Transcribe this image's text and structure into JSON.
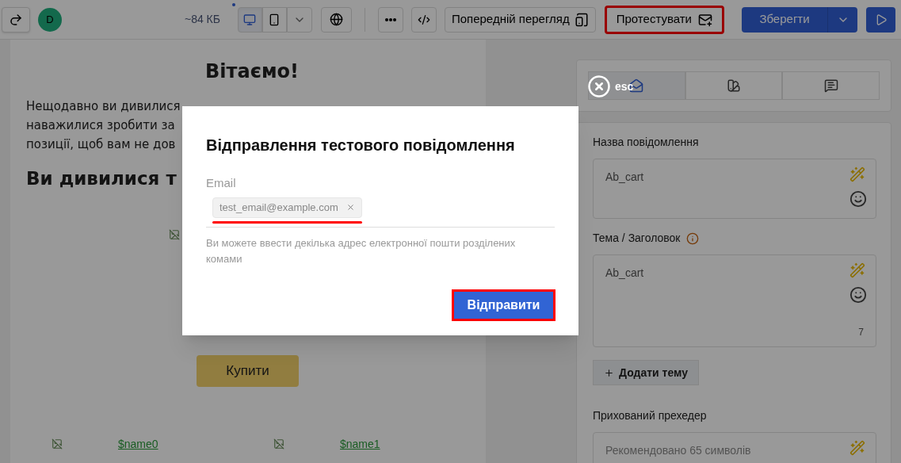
{
  "toolbar": {
    "avatar": "D",
    "size": "~84 КБ",
    "devices": [
      {
        "kind": "desktop",
        "selected": true
      },
      {
        "kind": "mobile",
        "selected": false
      }
    ],
    "preview_button": "Попередній перегляд",
    "test_button": {
      "label": "Протестувати",
      "highlighted": true
    },
    "save_button": "Зберегти"
  },
  "email_preview": {
    "greeting": "Вітаємо!",
    "intro_lines": [
      "Нещодавно ви дивилися",
      "наважилися зробити за",
      "позиції, щоб вам не дов"
    ],
    "section_heading": "Ви дивилися т",
    "buy_button": "Купити",
    "products": [
      {
        "name": "$name0"
      },
      {
        "name": "$name1"
      }
    ]
  },
  "settings": {
    "tabs": [
      {
        "kind": "envelope",
        "selected": true
      },
      {
        "kind": "palette",
        "selected": false
      },
      {
        "kind": "chat",
        "selected": false
      }
    ],
    "fields": [
      {
        "label": "Назва повідомлення",
        "value": "Ab_cart",
        "warning": false
      },
      {
        "label": "Тема / Заголовок",
        "value": "Ab_cart",
        "warning": true,
        "count": "7"
      }
    ],
    "add_subject_button": "Додати тему",
    "preheader": {
      "label": "Прихований прехедер",
      "placeholder": "Рекомендовано 65 символів"
    }
  },
  "dialog": {
    "close_hint": "esc",
    "title": "Відправлення тестового повідомлення",
    "email_label": "Email",
    "emails": [
      {
        "value": "test_email@example.com",
        "underlined": true
      }
    ],
    "hint": "Ви можете ввести декілька адрес електронної пошти розділених комами",
    "send_button": {
      "label": "Відправити",
      "highlighted": true
    }
  }
}
